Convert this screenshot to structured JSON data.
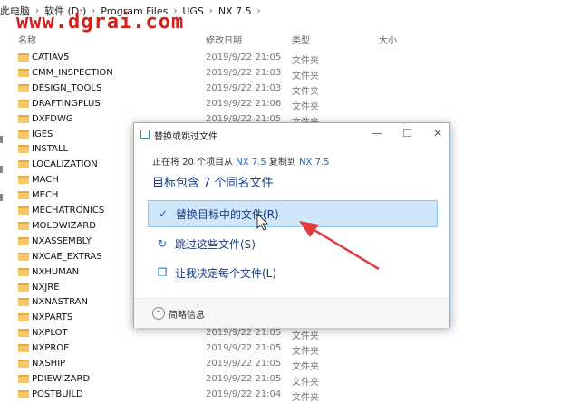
{
  "breadcrumb": [
    "此电脑",
    "软件 (D:)",
    "Program Files",
    "UGS",
    "NX 7.5"
  ],
  "watermark": "www.dgrai.com",
  "columns": {
    "name": "名称",
    "date": "修改日期",
    "type": "类型",
    "size": "大小"
  },
  "folders": [
    {
      "name": "CATIAV5",
      "date": "2019/9/22 21:05",
      "type": "文件夹"
    },
    {
      "name": "CMM_INSPECTION",
      "date": "2019/9/22 21:03",
      "type": "文件夹"
    },
    {
      "name": "DESIGN_TOOLS",
      "date": "2019/9/22 21:03",
      "type": "文件夹"
    },
    {
      "name": "DRAFTINGPLUS",
      "date": "2019/9/22 21:06",
      "type": "文件夹"
    },
    {
      "name": "DXFDWG",
      "date": "2019/9/22 21:05",
      "type": "文件夹"
    },
    {
      "name": "IGES",
      "date": "",
      "type": ""
    },
    {
      "name": "INSTALL",
      "date": "",
      "type": ""
    },
    {
      "name": "LOCALIZATION",
      "date": "",
      "type": ""
    },
    {
      "name": "MACH",
      "date": "",
      "type": ""
    },
    {
      "name": "MECH",
      "date": "",
      "type": ""
    },
    {
      "name": "MECHATRONICS",
      "date": "",
      "type": ""
    },
    {
      "name": "MOLDWIZARD",
      "date": "",
      "type": ""
    },
    {
      "name": "NXASSEMBLY",
      "date": "",
      "type": ""
    },
    {
      "name": "NXCAE_EXTRAS",
      "date": "",
      "type": ""
    },
    {
      "name": "NXHUMAN",
      "date": "",
      "type": ""
    },
    {
      "name": "NXJRE",
      "date": "",
      "type": ""
    },
    {
      "name": "NXNASTRAN",
      "date": "",
      "type": ""
    },
    {
      "name": "NXPARTS",
      "date": "",
      "type": ""
    },
    {
      "name": "NXPLOT",
      "date": "2019/9/22 21:05",
      "type": "文件夹"
    },
    {
      "name": "NXPROE",
      "date": "2019/9/22 21:05",
      "type": "文件夹"
    },
    {
      "name": "NXSHIP",
      "date": "2019/9/22 21:05",
      "type": "文件夹"
    },
    {
      "name": "PDIEWIZARD",
      "date": "2019/9/22 21:05",
      "type": "文件夹"
    },
    {
      "name": "POSTBUILD",
      "date": "2019/9/22 21:04",
      "type": "文件夹"
    }
  ],
  "dialog": {
    "title": "替换或跳过文件",
    "info_prefix": "正在将 20 个项目从",
    "from": "NX 7.5",
    "info_mid": "复制到",
    "to": "NX 7.5",
    "heading": "目标包含 7 个同名文件",
    "options": [
      {
        "label": "替换目标中的文件(R)",
        "icon": "check-icon",
        "glyph": "✓"
      },
      {
        "label": "跳过这些文件(S)",
        "icon": "skip-icon",
        "glyph": "↻"
      },
      {
        "label": "让我决定每个文件(L)",
        "icon": "files-icon",
        "glyph": "❐"
      }
    ],
    "footer": "简略信息",
    "minimize": "—",
    "maximize": "☐",
    "close": "✕"
  },
  "colors": {
    "accent": "#1a66cc",
    "selected": "#cfe6fb",
    "arrow": "#e03c3c",
    "folder": "#f6c86a"
  }
}
